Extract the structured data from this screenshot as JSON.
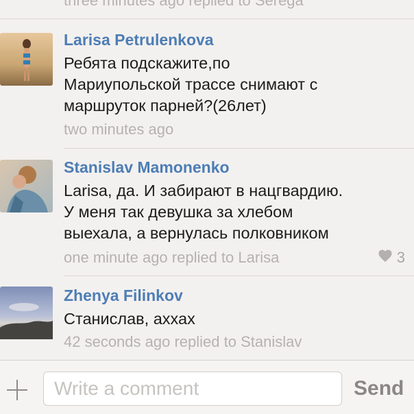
{
  "previous": {
    "meta": "three minutes ago replied to Serega"
  },
  "comments": [
    {
      "author": "Larisa Petrulenkova",
      "text": "Ребята подскажите,по\nМариупольской трассе снимают с\nмаршруток парней?(26лет)",
      "meta": "two minutes ago"
    },
    {
      "author": "Stanislav Mamonenko",
      "text": "Larisa, да. И забирают в нацгвардию.\nУ меня так девушка за хлебом\nвыехала,  а вернулась полковником",
      "meta": "one minute ago replied to Larisa",
      "likes": "3"
    },
    {
      "author": "Zhenya Filinkov",
      "text": "Станислав, аххах",
      "meta": "42 seconds ago replied to Stanislav"
    }
  ],
  "composer": {
    "placeholder": "Write a comment",
    "send_label": "Send"
  },
  "icons": {
    "add": "plus-icon",
    "like": "heart-icon"
  },
  "colors": {
    "author": "#4d7db5",
    "meta": "#b5b2af",
    "background": "#f3f1ef"
  }
}
